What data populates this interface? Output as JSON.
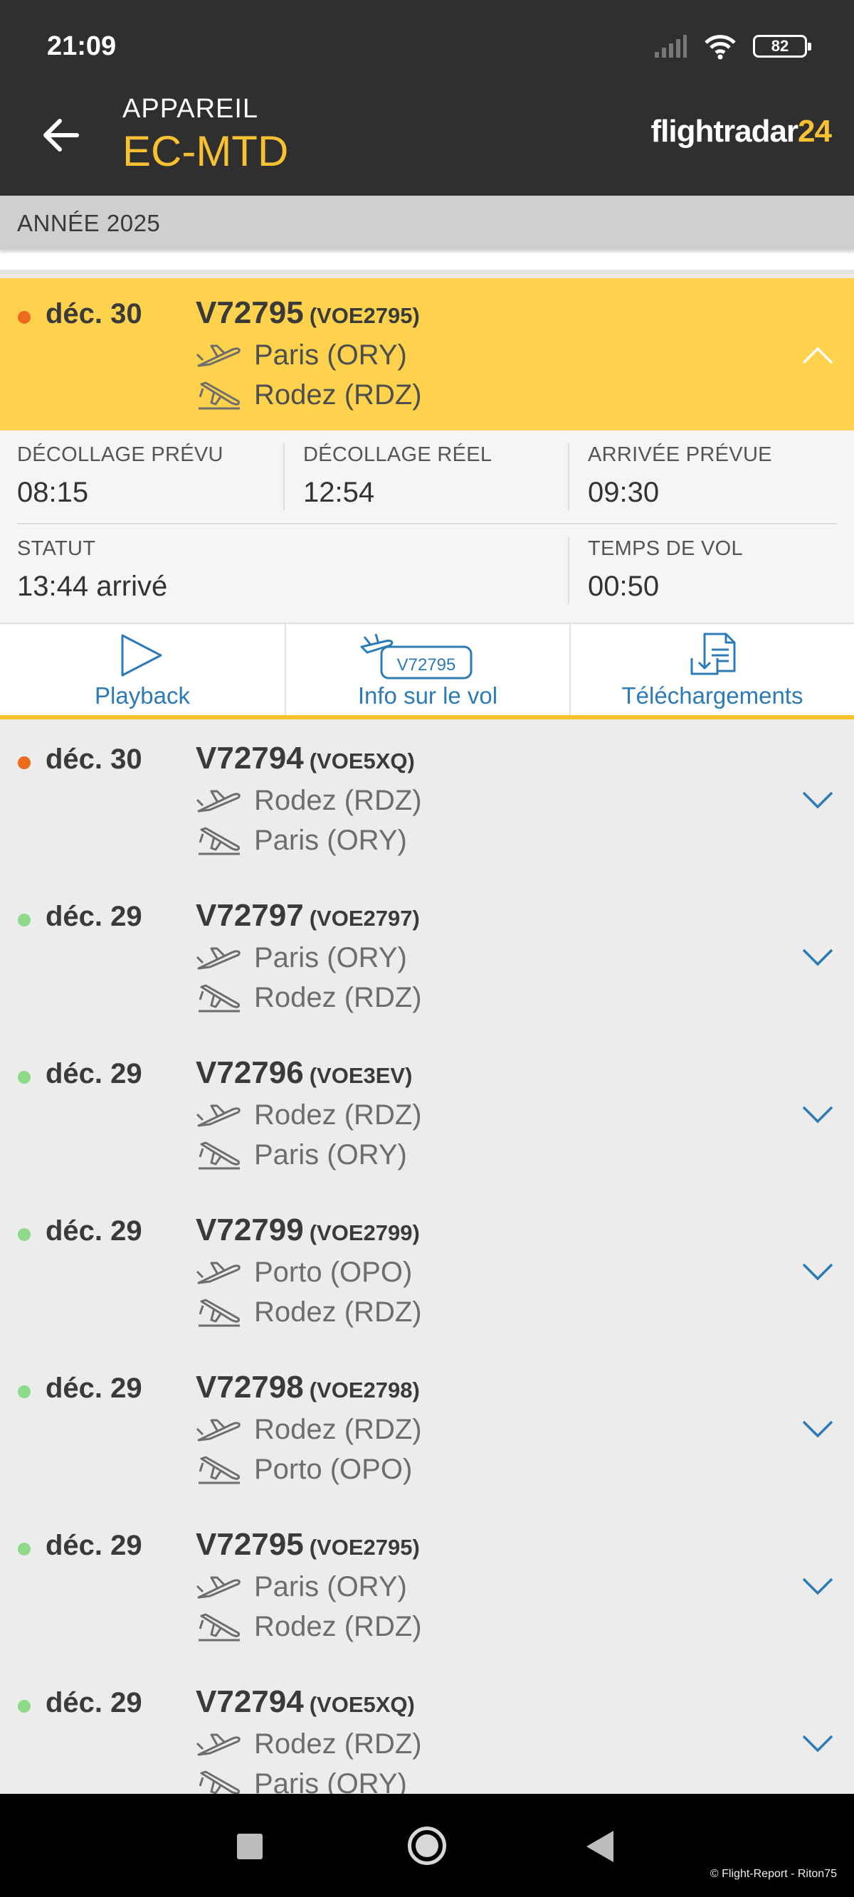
{
  "status_bar": {
    "time": "21:09",
    "battery": "82"
  },
  "header": {
    "subtitle": "APPAREIL",
    "registration": "EC-MTD",
    "logo_text": "flightradar",
    "logo_number": "24"
  },
  "year_label": "ANNÉE 2025",
  "colors": {
    "accent": "#f7c131",
    "link": "#2c7bb6",
    "dot_orange": "#ed6a1f",
    "dot_green": "#8fd98b"
  },
  "flights": [
    {
      "date": "déc. 30",
      "flight": "V72795",
      "callsign": "(VOE2795)",
      "from": "Paris (ORY)",
      "to": "Rodez (RDZ)",
      "status_dot": "orange",
      "expanded": true
    },
    {
      "date": "déc. 30",
      "flight": "V72794",
      "callsign": "(VOE5XQ)",
      "from": "Rodez (RDZ)",
      "to": "Paris (ORY)",
      "status_dot": "orange",
      "expanded": false
    },
    {
      "date": "déc. 29",
      "flight": "V72797",
      "callsign": "(VOE2797)",
      "from": "Paris (ORY)",
      "to": "Rodez (RDZ)",
      "status_dot": "green",
      "expanded": false
    },
    {
      "date": "déc. 29",
      "flight": "V72796",
      "callsign": "(VOE3EV)",
      "from": "Rodez (RDZ)",
      "to": "Paris (ORY)",
      "status_dot": "green",
      "expanded": false
    },
    {
      "date": "déc. 29",
      "flight": "V72799",
      "callsign": "(VOE2799)",
      "from": "Porto (OPO)",
      "to": "Rodez (RDZ)",
      "status_dot": "green",
      "expanded": false
    },
    {
      "date": "déc. 29",
      "flight": "V72798",
      "callsign": "(VOE2798)",
      "from": "Rodez (RDZ)",
      "to": "Porto (OPO)",
      "status_dot": "green",
      "expanded": false
    },
    {
      "date": "déc. 29",
      "flight": "V72795",
      "callsign": "(VOE2795)",
      "from": "Paris (ORY)",
      "to": "Rodez (RDZ)",
      "status_dot": "green",
      "expanded": false
    },
    {
      "date": "déc. 29",
      "flight": "V72794",
      "callsign": "(VOE5XQ)",
      "from": "Rodez (RDZ)",
      "to": "Paris (ORY)",
      "status_dot": "green",
      "expanded": false
    }
  ],
  "details": {
    "scheduled_departure_label": "DÉCOLLAGE PRÉVU",
    "scheduled_departure": "08:15",
    "actual_departure_label": "DÉCOLLAGE RÉEL",
    "actual_departure": "12:54",
    "scheduled_arrival_label": "ARRIVÉE PRÉVUE",
    "scheduled_arrival": "09:30",
    "status_label": "STATUT",
    "status": "13:44 arrivé",
    "flight_time_label": "TEMPS DE VOL",
    "flight_time": "00:50"
  },
  "actions": {
    "playback": "Playback",
    "flight_info": "Info sur le vol",
    "flight_info_badge": "V72795",
    "downloads": "Téléchargements"
  },
  "footer_credit": "© Flight-Report - Riton75"
}
